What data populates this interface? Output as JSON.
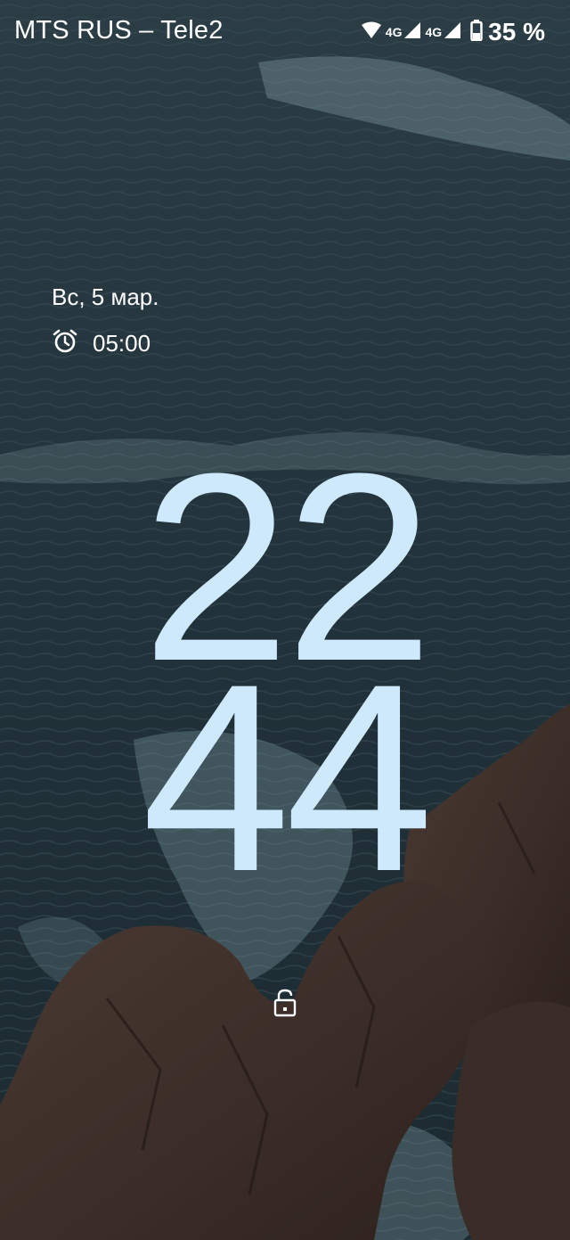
{
  "status_bar": {
    "carrier": "MTS RUS – Tele2",
    "network_1": "4G",
    "network_2": "4G",
    "battery_percent": "35 %",
    "icons": [
      "wifi-icon",
      "signal-icon",
      "signal-icon",
      "battery-icon"
    ]
  },
  "lockscreen": {
    "date": "Вс, 5 мар.",
    "alarm_icon": "alarm-clock-icon",
    "alarm_time": "05:00",
    "clock_hours": "22",
    "clock_minutes": "44",
    "lock_icon": "lock-icon"
  },
  "colors": {
    "clock": "#cde9fb",
    "text": "#ffffff",
    "sea": "#22333b",
    "rock": "#3f2f29"
  }
}
